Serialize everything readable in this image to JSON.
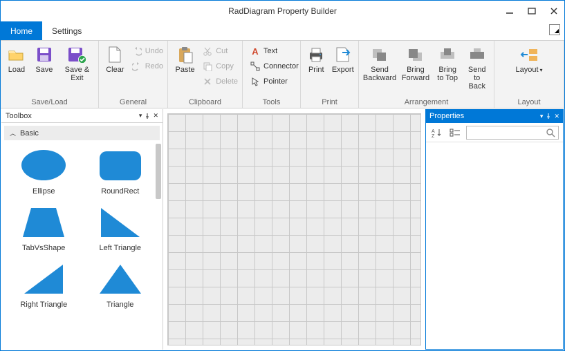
{
  "window": {
    "title": "RadDiagram Property Builder"
  },
  "tabs": {
    "home": "Home",
    "settings": "Settings"
  },
  "ribbon": {
    "saveload": {
      "title": "Save/Load",
      "load": "Load",
      "save": "Save",
      "saveExit": "Save & Exit"
    },
    "general": {
      "title": "General",
      "clear": "Clear",
      "undo": "Undo",
      "redo": "Redo"
    },
    "clipboard": {
      "title": "Clipboard",
      "paste": "Paste",
      "cut": "Cut",
      "copy": "Copy",
      "delete": "Delete"
    },
    "tools": {
      "title": "Tools",
      "text": "Text",
      "connector": "Connector",
      "pointer": "Pointer"
    },
    "print": {
      "title": "Print",
      "print": "Print",
      "export": "Export"
    },
    "arrangement": {
      "title": "Arrangement",
      "sendBackward": "Send\nBackward",
      "bringForward": "Bring\nForward",
      "bringToTop": "Bring\nto Top",
      "sendToBack": "Send\nto Back"
    },
    "layout": {
      "title": "Layout",
      "layout": "Layout"
    }
  },
  "toolbox": {
    "title": "Toolbox",
    "section": "Basic",
    "shapes": {
      "ellipse": "Ellipse",
      "roundrect": "RoundRect",
      "tabvsshape": "TabVsShape",
      "leftTriangle": "Left Triangle",
      "rightTriangle": "Right Triangle",
      "triangle": "Triangle"
    }
  },
  "properties": {
    "title": "Properties",
    "searchPlaceholder": ""
  }
}
